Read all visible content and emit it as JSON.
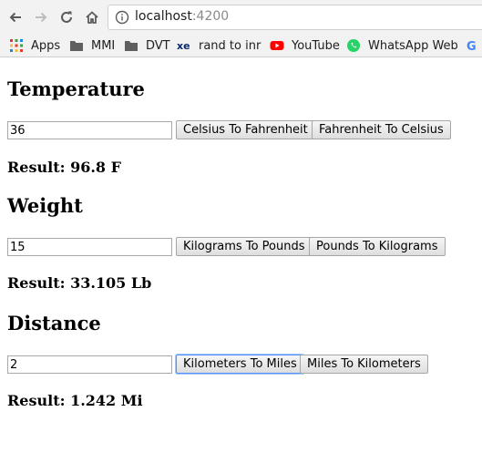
{
  "browser": {
    "url_host": "localhost",
    "url_port": ":4200",
    "bookmarks": [
      {
        "label": "Apps",
        "icon": "apps-grid-icon"
      },
      {
        "label": "MMI",
        "icon": "folder-icon"
      },
      {
        "label": "DVT",
        "icon": "folder-icon"
      },
      {
        "label": "rand to inr",
        "icon": "xe-icon"
      },
      {
        "label": "YouTube",
        "icon": "youtube-icon"
      },
      {
        "label": "WhatsApp Web",
        "icon": "whatsapp-icon"
      }
    ]
  },
  "temperature": {
    "title": "Temperature",
    "input_value": "36",
    "button_1": "Celsius To Fahrenheit",
    "button_2": "Fahrenheit To Celsius",
    "result": "Result: 96.8 F"
  },
  "weight": {
    "title": "Weight",
    "input_value": "15",
    "button_1": "Kilograms To Pounds",
    "button_2": "Pounds To Kilograms",
    "result": "Result: 33.105 Lb"
  },
  "distance": {
    "title": "Distance",
    "input_value": "2",
    "button_1": "Kilometers To Miles",
    "button_2": "Miles To Kilometers",
    "result": "Result: 1.242 Mi"
  },
  "colors": {
    "chrome_bg": "#f2f2f2",
    "focus_ring": "#4d90fe",
    "youtube_red": "#ff0000",
    "whatsapp_green": "#25d366"
  }
}
